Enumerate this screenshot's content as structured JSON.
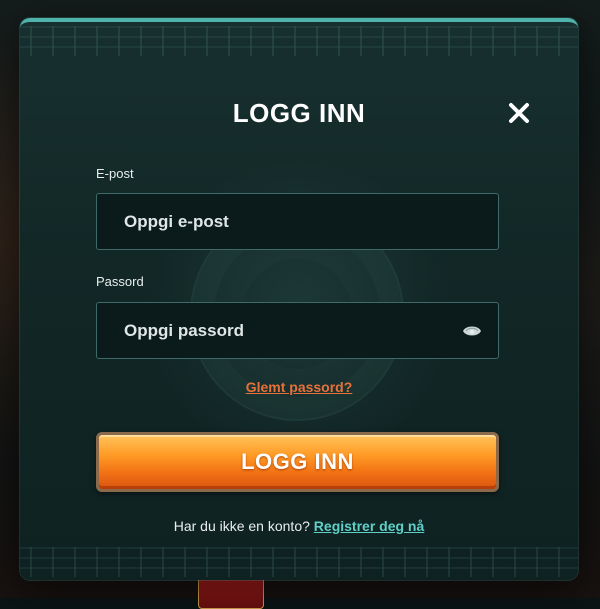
{
  "modal": {
    "title": "LOGG INN",
    "close_icon": "close-icon"
  },
  "email": {
    "label": "E-post",
    "placeholder": "Oppgi e-post",
    "value": ""
  },
  "password": {
    "label": "Passord",
    "placeholder": "Oppgi passord",
    "value": "",
    "toggle_icon": "eye-icon"
  },
  "forgot_password": {
    "label": "Glemt passord?"
  },
  "login_button": {
    "label": "LOGG INN"
  },
  "register": {
    "prompt": "Har du ikke en konto?",
    "link_label": "Registrer deg nå"
  },
  "colors": {
    "modal_border": "#4fb3ac",
    "link_orange": "#e8713a",
    "link_teal": "#5fd0c8",
    "button_orange": "#ff9a25"
  }
}
